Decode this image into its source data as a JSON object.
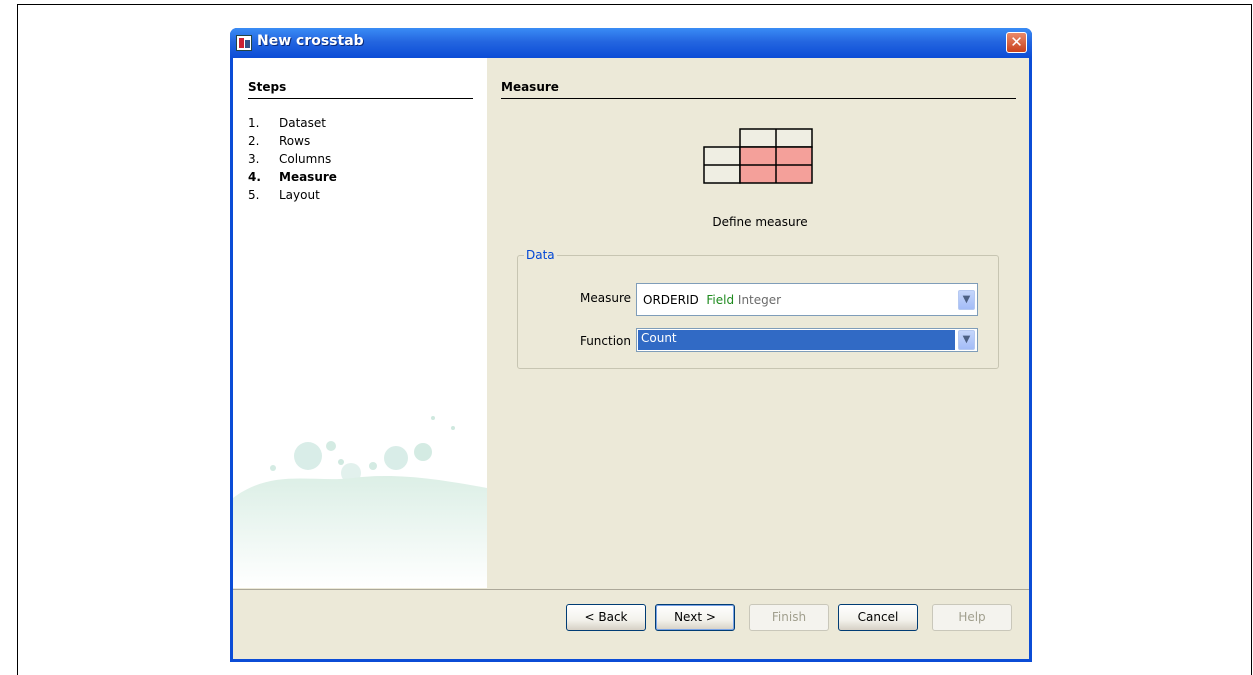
{
  "window": {
    "title": "New crosstab",
    "close_glyph": "✕"
  },
  "steps": {
    "title": "Steps",
    "items": [
      {
        "num": "1.",
        "label": "Dataset"
      },
      {
        "num": "2.",
        "label": "Rows"
      },
      {
        "num": "3.",
        "label": "Columns"
      },
      {
        "num": "4.",
        "label": "Measure"
      },
      {
        "num": "5.",
        "label": "Layout"
      }
    ],
    "active_index": 3
  },
  "main": {
    "title": "Measure",
    "description": "Define measure",
    "group_legend": "Data",
    "measure": {
      "label": "Measure",
      "value_name": "ORDERID",
      "value_type": "Field",
      "value_datatype": "Integer"
    },
    "function": {
      "label": "Function",
      "value": "Count"
    },
    "colors": {
      "highlight_cells": "#f4a09a",
      "selection": "#316ac5"
    }
  },
  "buttons": {
    "back": "< Back",
    "next": "Next >",
    "finish": "Finish",
    "cancel": "Cancel",
    "help": "Help"
  }
}
